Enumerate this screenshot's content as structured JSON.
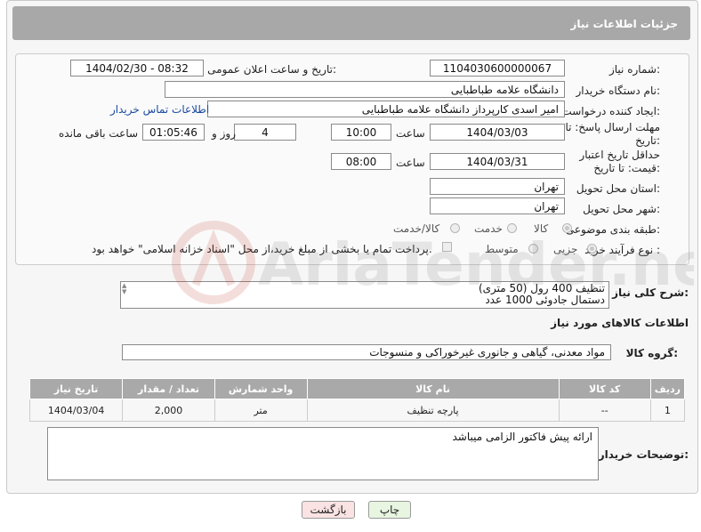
{
  "header": {
    "title": "جزئیات اطلاعات نیاز"
  },
  "form": {
    "need_number_label": "شماره نیاز:",
    "need_number": "1104030600000067",
    "announce_label": "تاریخ و ساعت اعلان عمومی:",
    "announce_value": "1404/02/30 - 08:32",
    "buyer_org_label": "نام دستگاه خریدار:",
    "buyer_org": "دانشگاه علامه طباطبایی",
    "creator_label": "ایجاد کننده درخواست:",
    "creator": "امیر اسدی کارپرداز دانشگاه علامه طباطبایی",
    "contact_link": "اطلاعات تماس خریدار",
    "deadline_label": "مهلت ارسال پاسخ: تا تاریخ:",
    "deadline_date": "1404/03/03",
    "time_label": "ساعت",
    "deadline_time": "10:00",
    "days_value": "4",
    "days_label": "روز و",
    "remaining_time": "01:05:46",
    "remaining_label": "ساعت باقی مانده",
    "validity_label": "حداقل تاریخ اعتبار قیمت: تا تاریخ:",
    "validity_date": "1404/03/31",
    "validity_time": "08:00",
    "province_label": "استان محل تحویل:",
    "province": "تهران",
    "city_label": "شهر محل تحویل:",
    "city": "تهران",
    "category_label": "طبقه بندی موضوعی:",
    "category_options": [
      "کالا",
      "خدمت",
      "کالا/خدمت"
    ],
    "process_label": "نوع فرآیند خرید :",
    "process_options": [
      "جزیی",
      "متوسط"
    ],
    "payment_note": "پرداخت تمام یا بخشی از مبلغ خرید،از محل \"اسناد خزانه اسلامی\" خواهد بود."
  },
  "description": {
    "label": "شرح کلی نیاز:",
    "lines": [
      "تنظیف 400 رول (50 متری)",
      "دستمال جادوئی 1000 عدد"
    ]
  },
  "goods": {
    "section_title": "اطلاعات کالاهای مورد نیاز",
    "group_label": "گروه کالا:",
    "group_value": "مواد معدنی، گیاهی و جانوری غیرخوراکی و منسوجات",
    "columns": [
      "ردیف",
      "کد کالا",
      "نام کالا",
      "واحد شمارش",
      "تعداد / مقدار",
      "تاریخ نیاز"
    ],
    "rows": [
      [
        "1",
        "--",
        "پارچه تنظیف",
        "متر",
        "2,000",
        "1404/03/04"
      ]
    ]
  },
  "notes": {
    "label": "توضیحات خریدار:",
    "text": "ارائه پیش فاکتور الزامی میباشد"
  },
  "buttons": {
    "print": "چاپ",
    "back": "بازگشت"
  },
  "watermark": {
    "text": "AriaTender.neT"
  },
  "colors": {
    "header_bg": "#a8a8a8",
    "link": "#1a4a9e",
    "print_btn": "#e8f5e0",
    "back_btn": "#fbe3e3"
  }
}
